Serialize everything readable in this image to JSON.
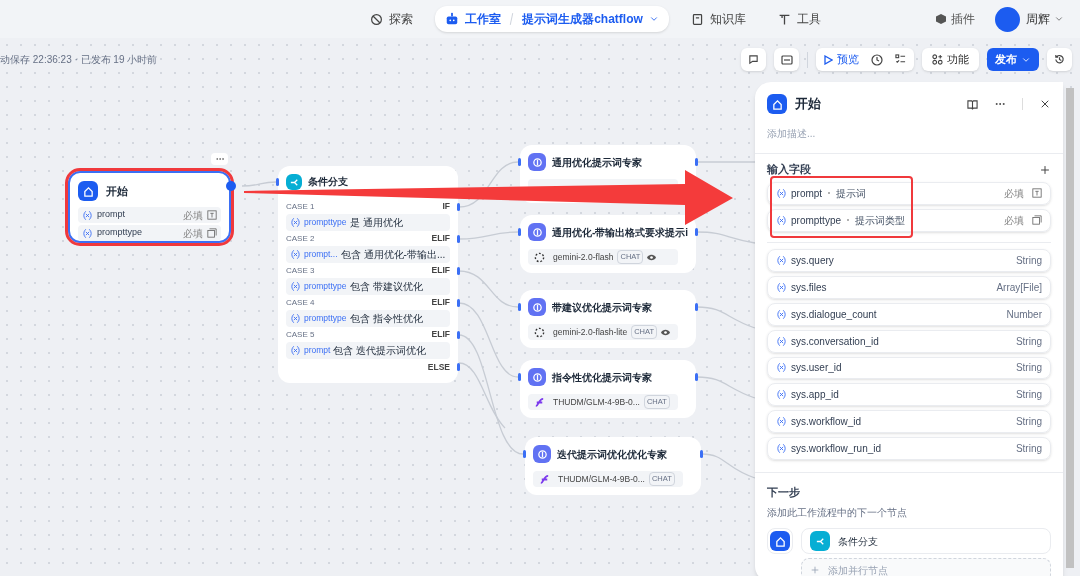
{
  "nav": {
    "items": [
      {
        "label": "探索",
        "selected": false,
        "kind": "explore"
      },
      {
        "label": "工作室",
        "selected": true,
        "kind": "studio",
        "app": "提示词生成器chatflow"
      },
      {
        "label": "知识库",
        "selected": false,
        "kind": "knowledge"
      },
      {
        "label": "工具",
        "selected": false,
        "kind": "tools"
      }
    ],
    "plugins": "插件",
    "user": "周辉"
  },
  "toolbar": {
    "status": "动保存 22:36:23 · 已发布 19 小时前",
    "preview": "预览",
    "features": "功能",
    "publish": "发布"
  },
  "start_node": {
    "title": "开始",
    "selected": true,
    "fields": [
      {
        "name": "prompt",
        "required": "必填",
        "kind": "text"
      },
      {
        "name": "prompttype",
        "required": "必填",
        "kind": "select"
      }
    ]
  },
  "condition_node": {
    "title": "条件分支",
    "cases": [
      {
        "label": "CASE 1",
        "tag": "IF",
        "variable": "prompttype",
        "operator": "是",
        "value": "通用优化"
      },
      {
        "label": "CASE 2",
        "tag": "ELIF",
        "variable": "prompt...",
        "operator": "包含",
        "value": "通用优化-带输出..."
      },
      {
        "label": "CASE 3",
        "tag": "ELIF",
        "variable": "prompttype",
        "operator": "包含",
        "value": "带建议优化"
      },
      {
        "label": "CASE 4",
        "tag": "ELIF",
        "variable": "prompttype",
        "operator": "包含",
        "value": "指令性优化"
      },
      {
        "label": "CASE 5",
        "tag": "ELIF",
        "variable": "prompt",
        "operator": "包含",
        "value": "迭代提示词优化"
      }
    ],
    "else": "ELSE"
  },
  "llm_nodes": [
    {
      "title": "通用优化提示词专家"
    },
    {
      "title": "通用优化-带输出格式要求提示i",
      "model": "gemini-2.0-flash",
      "kind": "gemini",
      "badge": "CHAT",
      "vision": true
    },
    {
      "title": "带建议优化提示词专家",
      "model": "gemini-2.0-flash-lite",
      "kind": "gemini",
      "badge": "CHAT",
      "vision": true
    },
    {
      "title": "指令性优化提示词专家",
      "model": "THUDM/GLM-4-9B-0...",
      "kind": "glm",
      "badge": "CHAT",
      "vision": false
    },
    {
      "title": "迭代提示词优化优化专家",
      "model": "THUDM/GLM-4-9B-0...",
      "kind": "glm",
      "badge": "CHAT",
      "vision": false
    }
  ],
  "panel": {
    "title": "开始",
    "description_placeholder": "添加描述...",
    "inputs_heading": "输入字段",
    "inputs": [
      {
        "name": "prompt",
        "label": "提示词",
        "required": "必填",
        "kind": "text"
      },
      {
        "name": "prompttype",
        "label": "提示词类型",
        "required": "必填",
        "kind": "select"
      }
    ],
    "system_vars": [
      {
        "name": "sys.query",
        "type": "String"
      },
      {
        "name": "sys.files",
        "type": "Array[File]"
      },
      {
        "name": "sys.dialogue_count",
        "type": "Number"
      },
      {
        "name": "sys.conversation_id",
        "type": "String"
      },
      {
        "name": "sys.user_id",
        "type": "String"
      },
      {
        "name": "sys.app_id",
        "type": "String"
      },
      {
        "name": "sys.workflow_id",
        "type": "String"
      },
      {
        "name": "sys.workflow_run_id",
        "type": "String"
      }
    ],
    "next_heading": "下一步",
    "next_description": "添加此工作流程中的下一个节点",
    "next_node": "条件分支",
    "add_parallel": "添加并行节点"
  }
}
